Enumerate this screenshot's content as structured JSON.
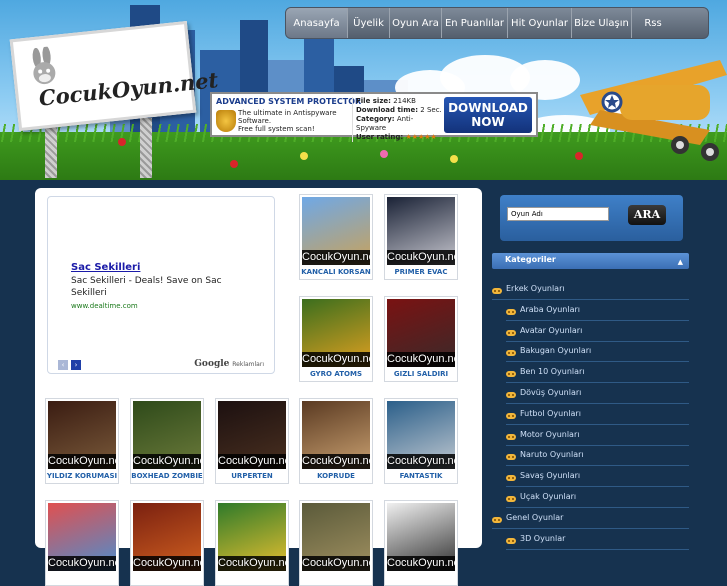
{
  "site": {
    "logo_text": "CocukOyun.net"
  },
  "nav": {
    "items": [
      "Anasayfa",
      "Üyelik",
      "Oyun Ara",
      "En Puanlılar",
      "Hit Oyunlar",
      "Bize Ulaşın",
      "Rss"
    ],
    "active": "Anasayfa"
  },
  "banner_ad": {
    "title": "ADVANCED SYSTEM PROTECTOR",
    "desc_1": "The ultimate in Antispyware",
    "desc_2": "Software.",
    "desc_3": "Free full system scan!",
    "spec_size_label": "File size:",
    "spec_size": "214KB",
    "spec_time_label": "Download time:",
    "spec_time": "2 Sec.",
    "spec_cat_label": "Category:",
    "spec_cat": "Anti- Spyware",
    "spec_rating_label": "User rating:",
    "spec_rating": "★★★★★",
    "download_line1": "DOWNLOAD",
    "download_line2": "NOW"
  },
  "text_ad": {
    "link": "Sac Sekilleri",
    "text": "Sac Sekilleri - Deals! Save on Sac Sekilleri",
    "url": "www.dealtime.com",
    "prev": "‹",
    "next": "›",
    "google": "Google",
    "google_sub": "Reklamları"
  },
  "watermark": "CocukOyun.net",
  "games": [
    {
      "name": "KANCALI KORSAN",
      "color1": "#6fa8e6",
      "color2": "#c9a25a"
    },
    {
      "name": "PRIMER EVAC",
      "color1": "#1a2236",
      "color2": "#c8c8d0"
    },
    {
      "name": "GYRO ATOMS",
      "color1": "#3b6e1e",
      "color2": "#e0a020"
    },
    {
      "name": "GIZLI SALDIRI",
      "color1": "#7a1212",
      "color2": "#3a2a2a"
    },
    {
      "name": "YILDIZ KORUMASI",
      "color1": "#3a1c12",
      "color2": "#7a5a3a"
    },
    {
      "name": "BOXHEAD ZOMBIE",
      "color1": "#2e4a1a",
      "color2": "#6b7a3a"
    },
    {
      "name": "ÜRPERTEN",
      "color1": "#1c1010",
      "color2": "#4a3020"
    },
    {
      "name": "KÖPRÜDE",
      "color1": "#5a3a22",
      "color2": "#c9a070"
    },
    {
      "name": "FANTASTIK",
      "color1": "#2b5f8a",
      "color2": "#c0c8d0"
    },
    {
      "name": "",
      "color1": "#e05050",
      "color2": "#4a8fd0"
    },
    {
      "name": "",
      "color1": "#7a2010",
      "color2": "#d06020"
    },
    {
      "name": "",
      "color1": "#2f7a2a",
      "color2": "#e8c030"
    },
    {
      "name": "",
      "color1": "#5a5a3a",
      "color2": "#a09060"
    },
    {
      "name": "",
      "color1": "#f0f0f0",
      "color2": "#303030"
    }
  ],
  "search": {
    "placeholder": "Oyun Adı",
    "button": "ARA"
  },
  "categories": {
    "title": "Kategoriler",
    "toggle": "▲",
    "items": [
      {
        "label": "Erkek Oyunları",
        "level": 0
      },
      {
        "label": "Araba Oyunları",
        "level": 1
      },
      {
        "label": "Avatar Oyunları",
        "level": 1
      },
      {
        "label": "Bakugan Oyunları",
        "level": 1
      },
      {
        "label": "Ben 10 Oyunları",
        "level": 1
      },
      {
        "label": "Dövüş Oyunları",
        "level": 1
      },
      {
        "label": "Futbol Oyunları",
        "level": 1
      },
      {
        "label": "Motor Oyunları",
        "level": 1
      },
      {
        "label": "Naruto Oyunları",
        "level": 1
      },
      {
        "label": "Savaş Oyunları",
        "level": 1
      },
      {
        "label": "Uçak Oyunları",
        "level": 1
      },
      {
        "label": "Genel Oyunlar",
        "level": 0
      },
      {
        "label": "3D Oyunlar",
        "level": 1
      }
    ]
  },
  "colors": {
    "page_bg": "#16324f",
    "accent_blue": "#2260a8",
    "category_text": "#cfe0f7"
  }
}
